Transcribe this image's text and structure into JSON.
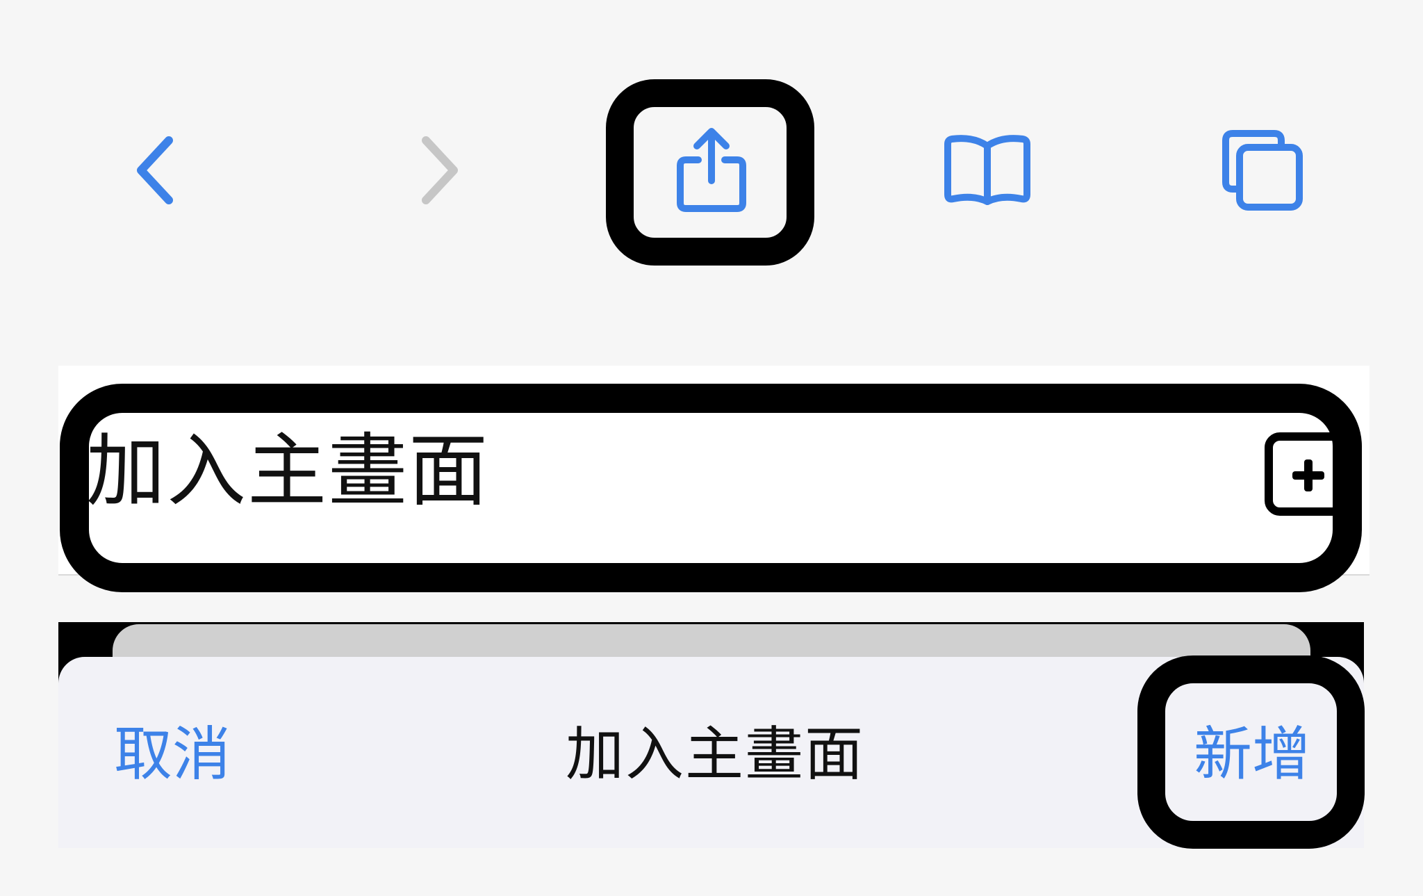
{
  "colors": {
    "accent": "#3d82e8",
    "disabled": "#c6c6c6",
    "background": "#f6f6f6",
    "highlight": "#000000"
  },
  "toolbar": {
    "back_icon": "chevron-left-icon",
    "forward_icon": "chevron-right-icon",
    "share_icon": "share-icon",
    "bookmarks_icon": "book-icon",
    "tabs_icon": "tabs-icon"
  },
  "share_sheet": {
    "action_label": "加入主畫面",
    "action_icon": "plus-square-icon"
  },
  "add_sheet": {
    "cancel_label": "取消",
    "title": "加入主畫面",
    "add_label": "新增"
  }
}
